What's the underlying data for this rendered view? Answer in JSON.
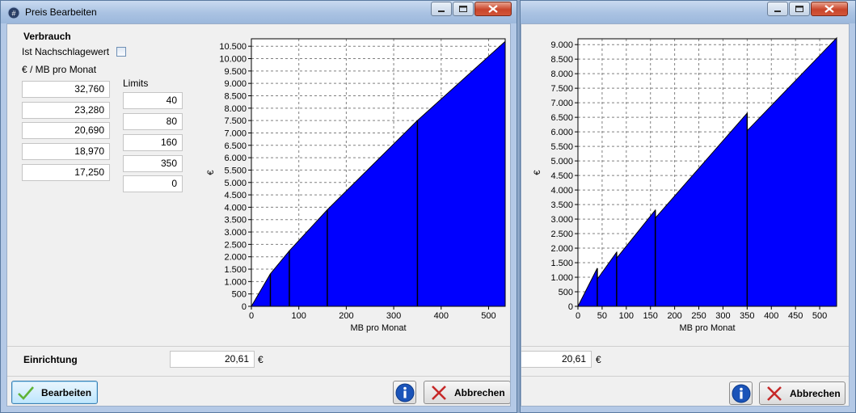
{
  "windows": [
    {
      "title": "Preis Bearbeiten",
      "verbrauch_label": "Verbrauch",
      "nachschlage_label": "Ist Nachschlagewert",
      "nachschlage_checked": false,
      "price_unit_label": "€ / MB pro Monat",
      "limits_label": "Limits",
      "prices": [
        "32,760",
        "23,280",
        "20,690",
        "18,970",
        "17,250"
      ],
      "limits": [
        "40",
        "80",
        "160",
        "350",
        "0"
      ],
      "einrichtung_label": "Einrichtung",
      "einrichtung_value": "20,61",
      "currency": "€",
      "bearbeiten_label": "Bearbeiten",
      "abbrechen_label": "Abbrechen"
    },
    {
      "einrichtung_value": "20,61",
      "currency": "€",
      "abbrechen_label": "Abbrechen"
    }
  ],
  "colors": {
    "fill": "#0000ff",
    "close": "#c9452a"
  },
  "chart_data": [
    {
      "type": "area",
      "xlabel": "MB pro Monat",
      "ylabel": "€",
      "xlim": [
        0,
        535
      ],
      "ylim": [
        0,
        10800
      ],
      "xticks": [
        0,
        100,
        200,
        300,
        400,
        500
      ],
      "yticks": [
        0,
        500,
        1000,
        1500,
        2000,
        2500,
        3000,
        3500,
        4000,
        4500,
        5000,
        5500,
        6000,
        6500,
        7000,
        7500,
        8000,
        8500,
        9000,
        9500,
        10000,
        10500
      ],
      "xtick_labels": [
        "0",
        "100",
        "200",
        "300",
        "400",
        "500"
      ],
      "ytick_labels": [
        "0",
        "500",
        "1.000",
        "1.500",
        "2.000",
        "2.500",
        "3.000",
        "3.500",
        "4.000",
        "4.500",
        "5.000",
        "5.500",
        "6.000",
        "6.500",
        "7.000",
        "7.500",
        "8.000",
        "8.500",
        "9.000",
        "9.500",
        "10.000",
        "10.500"
      ],
      "grid": true,
      "segments": [
        [
          0,
          40,
          32.76
        ],
        [
          40,
          80,
          23.28
        ],
        [
          80,
          160,
          20.69
        ],
        [
          160,
          350,
          18.97
        ],
        [
          350,
          535,
          17.25
        ]
      ],
      "mode": "cumulative",
      "dividers": [
        40,
        80,
        160,
        350
      ]
    },
    {
      "type": "area",
      "xlabel": "MB pro Monat",
      "ylabel": "€",
      "xlim": [
        0,
        535
      ],
      "ylim": [
        0,
        9200
      ],
      "xticks": [
        0,
        50,
        100,
        150,
        200,
        250,
        300,
        350,
        400,
        450,
        500
      ],
      "yticks": [
        0,
        500,
        1000,
        1500,
        2000,
        2500,
        3000,
        3500,
        4000,
        4500,
        5000,
        5500,
        6000,
        6500,
        7000,
        7500,
        8000,
        8500,
        9000
      ],
      "xtick_labels": [
        "0",
        "50",
        "100",
        "150",
        "200",
        "250",
        "300",
        "350",
        "400",
        "450",
        "500"
      ],
      "ytick_labels": [
        "0",
        "500",
        "1.000",
        "1.500",
        "2.000",
        "2.500",
        "3.000",
        "3.500",
        "4.000",
        "4.500",
        "5.000",
        "5.500",
        "6.000",
        "6.500",
        "7.000",
        "7.500",
        "8.000",
        "8.500",
        "9.000"
      ],
      "grid": true,
      "segments": [
        [
          0,
          40,
          32.76
        ],
        [
          40,
          80,
          23.28
        ],
        [
          80,
          160,
          20.69
        ],
        [
          160,
          350,
          18.97
        ],
        [
          350,
          535,
          17.25
        ]
      ],
      "mode": "tiered",
      "dividers": [
        40,
        80,
        160,
        350
      ]
    }
  ]
}
